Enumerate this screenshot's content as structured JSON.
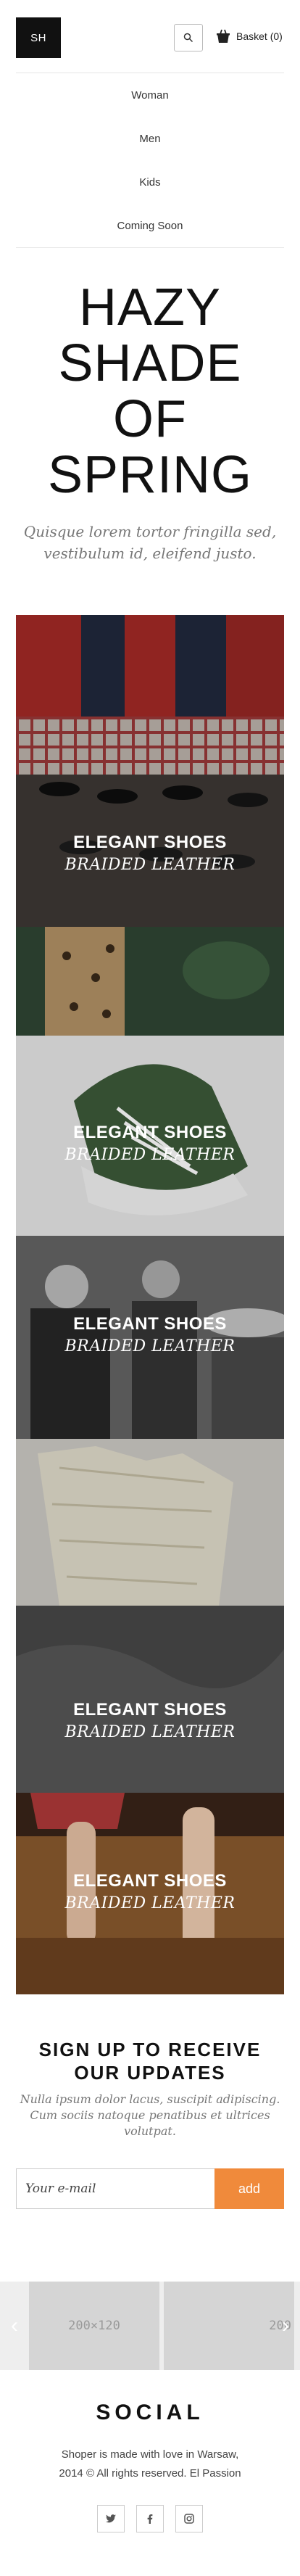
{
  "header": {
    "logo": "SH",
    "search_icon": "search-icon",
    "basket_icon": "basket-icon",
    "basket_label": "Basket (0)"
  },
  "nav": {
    "items": [
      "Woman",
      "Men",
      "Kids",
      "Coming Soon"
    ]
  },
  "hero": {
    "title_line1": "HAZY",
    "title_line2": "SHADE OF",
    "title_line3": "SPRING",
    "subtitle": "Quisque lorem tortor fringilla sed, vestibulum id, eleifend justo."
  },
  "tiles": [
    {
      "title": "ELEGANT SHOES",
      "subtitle": "BRAIDED LEATHER"
    },
    {
      "title": "ELEGANT SHOES",
      "subtitle": "BRAIDED LEATHER"
    },
    {
      "title": "ELEGANT SHOES",
      "subtitle": "BRAIDED LEATHER"
    },
    {
      "title": "ELEGANT SHOES",
      "subtitle": "BRAIDED LEATHER"
    },
    {
      "title": "ELEGANT SHOES",
      "subtitle": "BRAIDED LEATHER"
    }
  ],
  "signup": {
    "title": "SIGN UP TO RECEIVE OUR UPDATES",
    "text": "Nulla ipsum dolor lacus, suscipit adipiscing. Cum sociis natoque penatibus et ultrices volutpat.",
    "email_placeholder": "Your e-mail",
    "button_label": "add",
    "accent": "#f08a3b"
  },
  "carousel": {
    "slide_label": "200×120",
    "slide_label_cut": "200"
  },
  "social": {
    "title": "SOCIAL",
    "footer_line1": "Shoper is made with love in Warsaw,",
    "footer_line2": "2014 © All rights reserved. El Passion",
    "icons": [
      "twitter-icon",
      "facebook-icon",
      "instagram-icon"
    ]
  }
}
